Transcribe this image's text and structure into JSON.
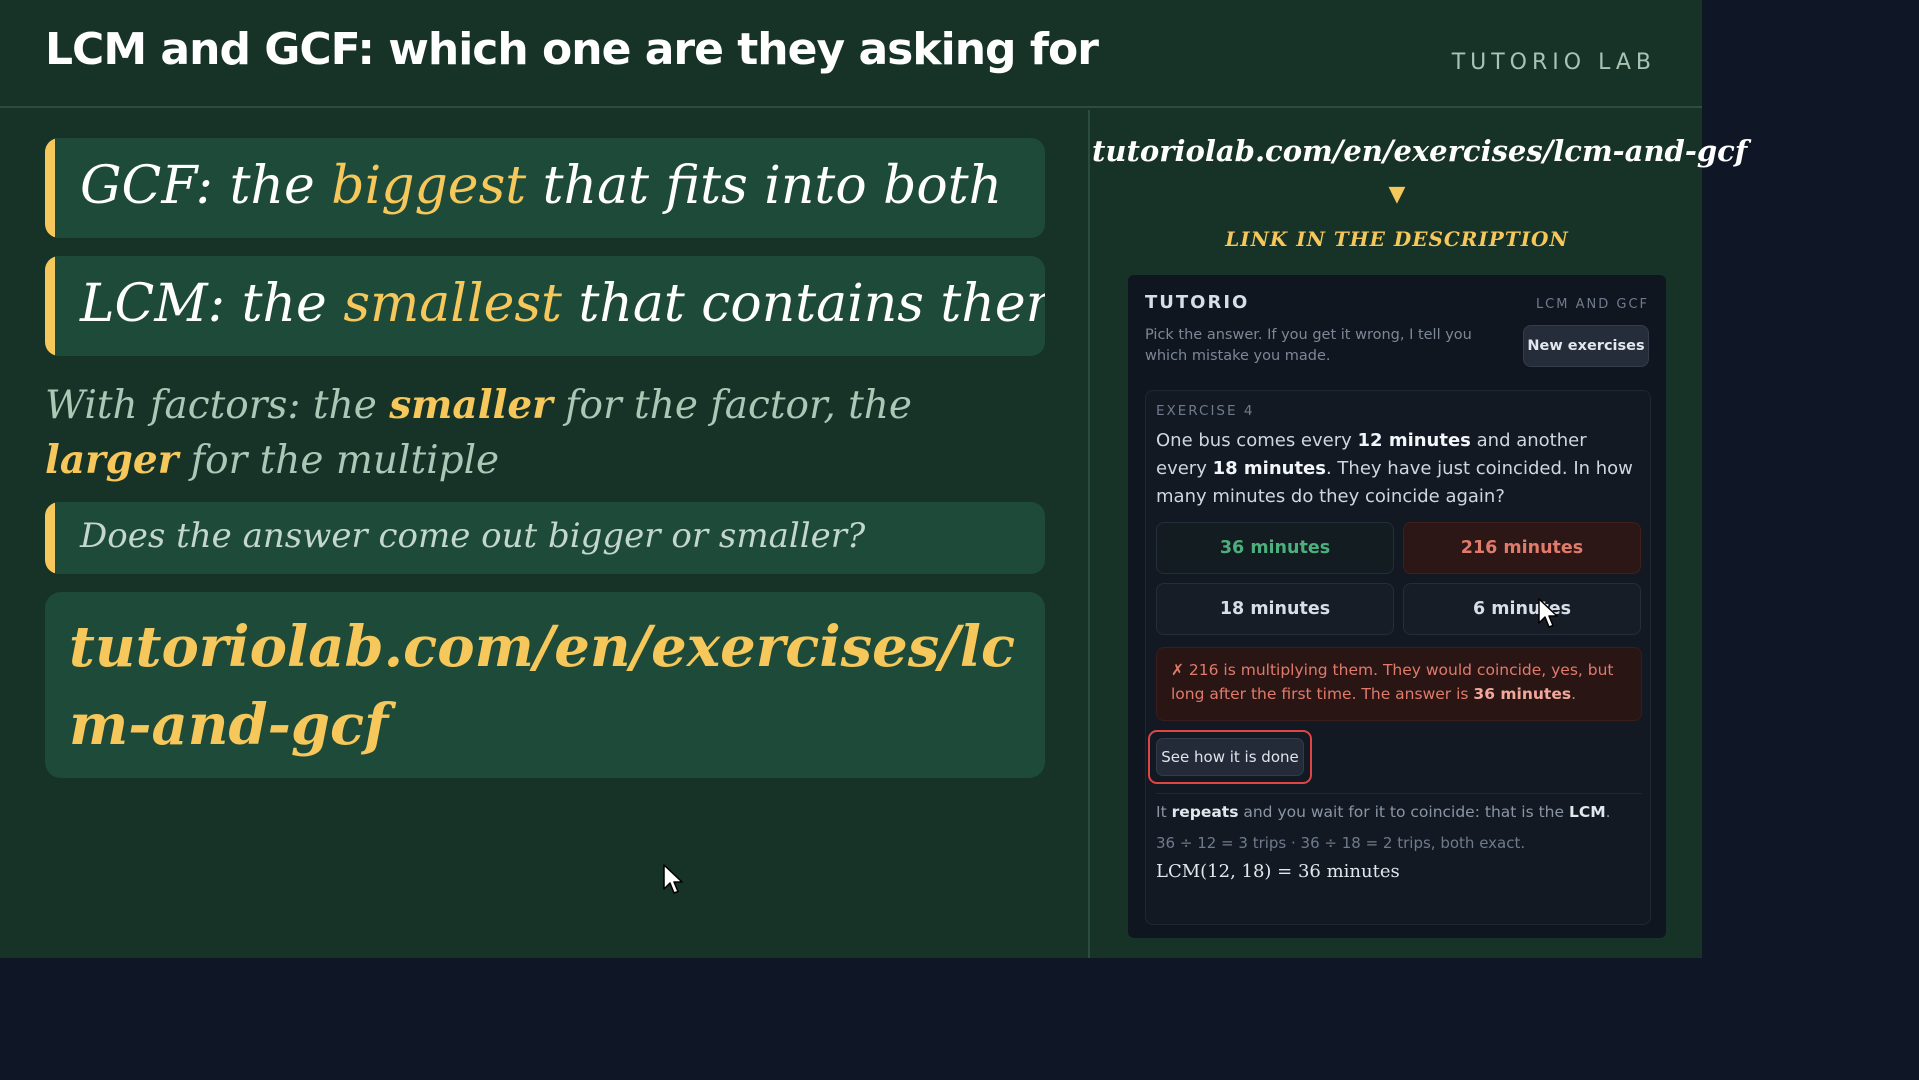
{
  "header": {
    "title": "LCM and GCF: which one are they asking for",
    "brand": "TUTORIO LAB"
  },
  "left": {
    "gcf": {
      "prefix": "GCF: the ",
      "highlight": "biggest",
      "suffix": " that fits into both"
    },
    "lcm": {
      "prefix": "LCM: the ",
      "highlight": "smallest",
      "suffix": " that contains them"
    },
    "factors": {
      "part1": "With factors: the ",
      "highlight1": "smaller",
      "part2": " for the factor, the ",
      "highlight2": "larger",
      "part3": " for the multiple"
    },
    "question": "Does the answer come out bigger or smaller?",
    "link": "tutoriolab.com/en/exercises/lcm-and-gcf"
  },
  "right": {
    "link": "tutoriolab.com/en/exercises/lcm-and-gcf",
    "arrow": "▼",
    "description": "LINK IN THE DESCRIPTION"
  },
  "panel": {
    "brand": "TUTORIO",
    "topic": "LCM AND GCF",
    "instruction": "Pick the answer. If you get it wrong, I tell you which mistake you made.",
    "new_exercises": "New exercises",
    "exercise": {
      "label": "EXERCISE 4",
      "q1": "One bus comes every ",
      "q_b1": "12 minutes",
      "q2": " and another every ",
      "q_b2": "18 minutes",
      "q3": ". They have just coincided. In how many minutes do they coincide again?",
      "options": [
        "36 minutes",
        "216 minutes",
        "18 minutes",
        "6 minutes"
      ],
      "feedback": {
        "text": "✗ 216 is multiplying them. They would coincide, yes, but long after the first time. The answer is ",
        "bold": "36 minutes",
        "end": "."
      },
      "see_how": "See how it is done",
      "explanation": {
        "p1": "It ",
        "b1": "repeats",
        "p2": " and you wait for it to coincide: that is the ",
        "b2": "LCM",
        "p3": ".",
        "line2": "36 ÷ 12 = 3 trips · 36 ÷ 18 = 2 trips, both exact.",
        "formula": "LCM(12, 18) = 36 minutes"
      }
    }
  },
  "colors": {
    "board": "#173328",
    "card": "#1e4a3a",
    "accent": "#f6c75a",
    "correct": "#4caf7d",
    "wrong": "#e07a6a",
    "highlight_ring": "#e04545"
  },
  "icons": [
    "mouse-cursor-icon",
    "arrow-down-icon"
  ]
}
